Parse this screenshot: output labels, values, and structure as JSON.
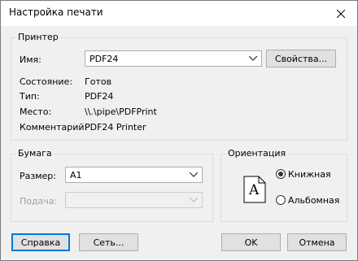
{
  "window": {
    "title": "Настройка печати"
  },
  "printer": {
    "group_label": "Принтер",
    "name_label": "Имя:",
    "name_value": "PDF24",
    "properties_button": "Свойства...",
    "status_label": "Состояние:",
    "status_value": "Готов",
    "type_label": "Тип:",
    "type_value": "PDF24",
    "location_label": "Место:",
    "location_value": "\\\\.\\pipe\\PDFPrint",
    "comment_label": "Комментарий:",
    "comment_value": "PDF24 Printer"
  },
  "paper": {
    "group_label": "Бумага",
    "size_label": "Размер:",
    "size_value": "A1",
    "source_label": "Подача:",
    "source_value": ""
  },
  "orientation": {
    "group_label": "Ориентация",
    "preview_letter": "A",
    "portrait_label": "Книжная",
    "landscape_label": "Альбомная",
    "selected": "portrait"
  },
  "buttons": {
    "help": "Справка",
    "network": "Сеть...",
    "ok": "OK",
    "cancel": "Отмена"
  },
  "icons": {
    "close": "close-icon",
    "chevron": "chevron-down-icon",
    "page": "page-icon"
  }
}
